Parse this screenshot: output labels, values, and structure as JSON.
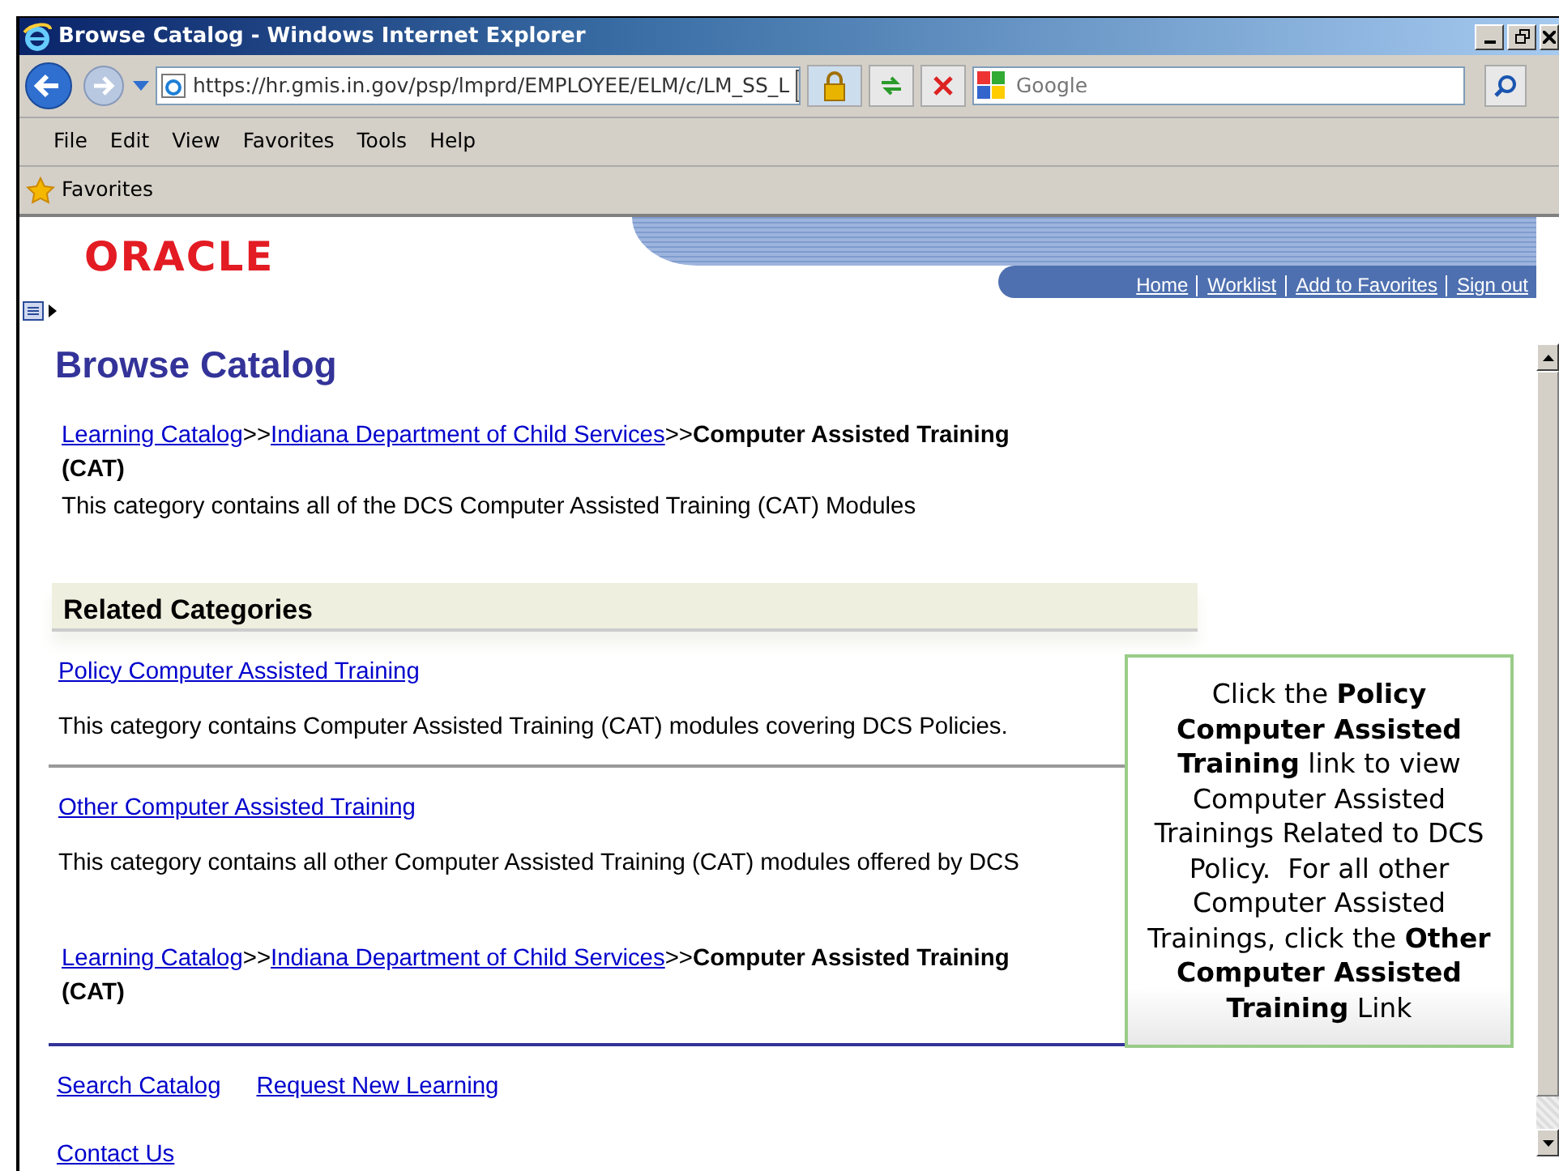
{
  "window": {
    "title": "Browse Catalog - Windows Internet Explorer"
  },
  "address_bar": {
    "url": "https://hr.gmis.in.gov/psp/lmprd/EMPLOYEE/ELM/c/LM_SS_L"
  },
  "search": {
    "placeholder": "Google"
  },
  "menu": [
    "File",
    "Edit",
    "View",
    "Favorites",
    "Tools",
    "Help"
  ],
  "favorites_bar": {
    "label": "Favorites"
  },
  "header": {
    "logo": "ORACLE",
    "nav_links": [
      "Home",
      "Worklist",
      "Add to Favorites",
      "Sign out"
    ]
  },
  "page": {
    "title": "Browse Catalog",
    "breadcrumb_top": [
      {
        "kind": "link",
        "text": "Learning Catalog"
      },
      {
        "kind": "separator",
        "text": ">>"
      },
      {
        "kind": "link",
        "text": "Indiana Department of Child Services"
      },
      {
        "kind": "separator",
        "text": ">>"
      },
      {
        "kind": "current",
        "text": "Computer Assisted Training (CAT)"
      }
    ],
    "description": "This category contains all of the DCS Computer Assisted Training (CAT) Modules",
    "related_heading": "Related Categories",
    "categories": [
      {
        "title": "Policy Computer Assisted Training",
        "description": "This category contains Computer Assisted Training (CAT) modules covering DCS Policies."
      },
      {
        "title": "Other Computer Assisted Training",
        "description": "This category contains all other Computer Assisted Training (CAT) modules offered by DCS"
      }
    ],
    "breadcrumb_bottom": [
      {
        "kind": "link",
        "text": "Learning Catalog"
      },
      {
        "kind": "separator",
        "text": ">>"
      },
      {
        "kind": "link",
        "text": "Indiana Department of Child Services"
      },
      {
        "kind": "separator",
        "text": ">>"
      },
      {
        "kind": "current",
        "text": "Computer Assisted Training (CAT)"
      }
    ],
    "footer_links": [
      "Search Catalog",
      "Request New Learning"
    ],
    "contact_link": "Contact Us"
  },
  "callout": {
    "text": "Click the **Policy Computer Assisted Training** link to view Computer Assisted Trainings Related to DCS Policy.  For all other Computer Assisted Trainings, click the **Other Computer Assisted Training** Link"
  }
}
